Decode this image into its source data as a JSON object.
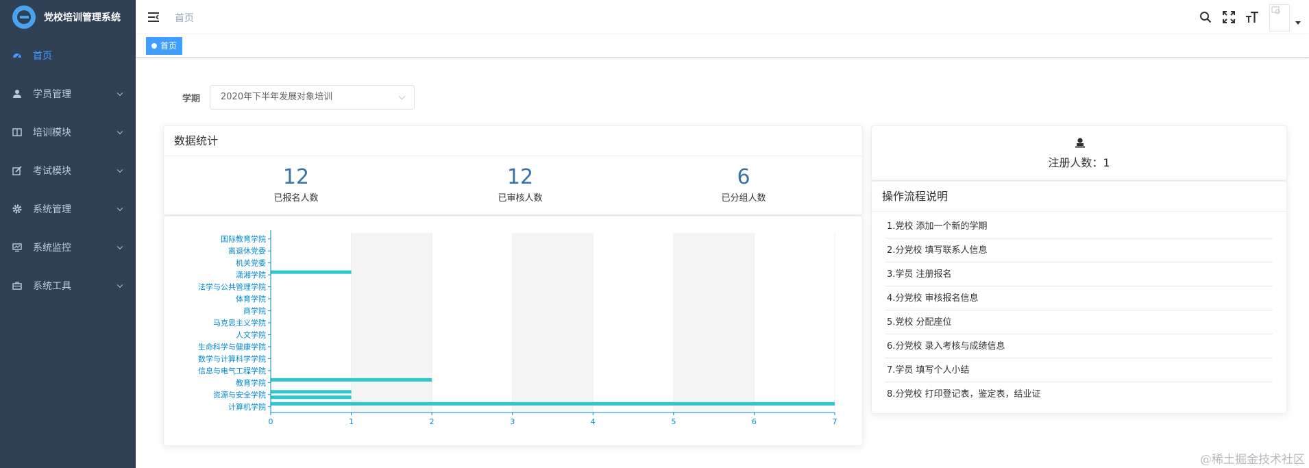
{
  "app": {
    "title": "党校培训管理系统"
  },
  "sidebar": {
    "items": [
      {
        "label": "首页",
        "icon": "dashboard-icon",
        "active": true,
        "has_submenu": false
      },
      {
        "label": "学员管理",
        "icon": "user-icon",
        "active": false,
        "has_submenu": true
      },
      {
        "label": "培训模块",
        "icon": "book-icon",
        "active": false,
        "has_submenu": true
      },
      {
        "label": "考试模块",
        "icon": "edit-icon",
        "active": false,
        "has_submenu": true
      },
      {
        "label": "系统管理",
        "icon": "gear-icon",
        "active": false,
        "has_submenu": true
      },
      {
        "label": "系统监控",
        "icon": "monitor-icon",
        "active": false,
        "has_submenu": true
      },
      {
        "label": "系统工具",
        "icon": "toolbox-icon",
        "active": false,
        "has_submenu": true
      }
    ]
  },
  "navbar": {
    "breadcrumb": "首页",
    "icons": [
      "search-icon",
      "fullscreen-icon",
      "font-size-icon"
    ]
  },
  "tags": {
    "active_tag": "首页"
  },
  "filter": {
    "label": "学期",
    "selected": "2020年下半年发展对象培训"
  },
  "stats": {
    "title": "数据统计",
    "items": [
      {
        "value": "12",
        "label": "已报名人数"
      },
      {
        "value": "12",
        "label": "已审核人数"
      },
      {
        "value": "6",
        "label": "已分组人数"
      }
    ]
  },
  "registration": {
    "text": "注册人数：1"
  },
  "flow": {
    "title": "操作流程说明",
    "steps": [
      "1.党校 添加一个新的学期",
      "2.分党校 填写联系人信息",
      "3.学员 注册报名",
      "4.分党校 审核报名信息",
      "5.党校 分配座位",
      "6.分党校 录入考核与成绩信息",
      "7.学员 填写个人小结",
      "8.分党校 打印登记表，鉴定表，结业证"
    ]
  },
  "colors": {
    "sidebar_bg": "#304156",
    "accent": "#409eff",
    "bar": "#2ec7c9",
    "axis": "#008acd",
    "stat_value": "#3873a8"
  },
  "chart_data": {
    "type": "bar",
    "orientation": "horizontal",
    "categories": [
      "国际教育学院",
      "离退休党委",
      "机关党委",
      "潇湘学院",
      "法学与公共管理学院",
      "体育学院",
      "商学院",
      "马克思主义学院",
      "人文学院",
      "生命科学与健康学院",
      "数学与计算科学学院",
      "信息与电气工程学院",
      "教育学院",
      "资源与安全学院",
      "计算机学院"
    ],
    "series": [
      {
        "values": [
          0,
          0,
          0,
          1,
          0,
          0,
          0,
          0,
          0,
          0,
          0,
          0,
          2,
          1,
          7
        ]
      },
      {
        "values": [
          0,
          0,
          0,
          0,
          0,
          0,
          0,
          0,
          0,
          0,
          0,
          0,
          0,
          1,
          0
        ]
      }
    ],
    "xlim": [
      0,
      7
    ],
    "xticks": [
      0,
      1,
      2,
      3,
      4,
      5,
      6,
      7
    ],
    "grid": "alternating vertical bands",
    "legend": "none"
  },
  "watermark": "@稀土掘金技术社区"
}
